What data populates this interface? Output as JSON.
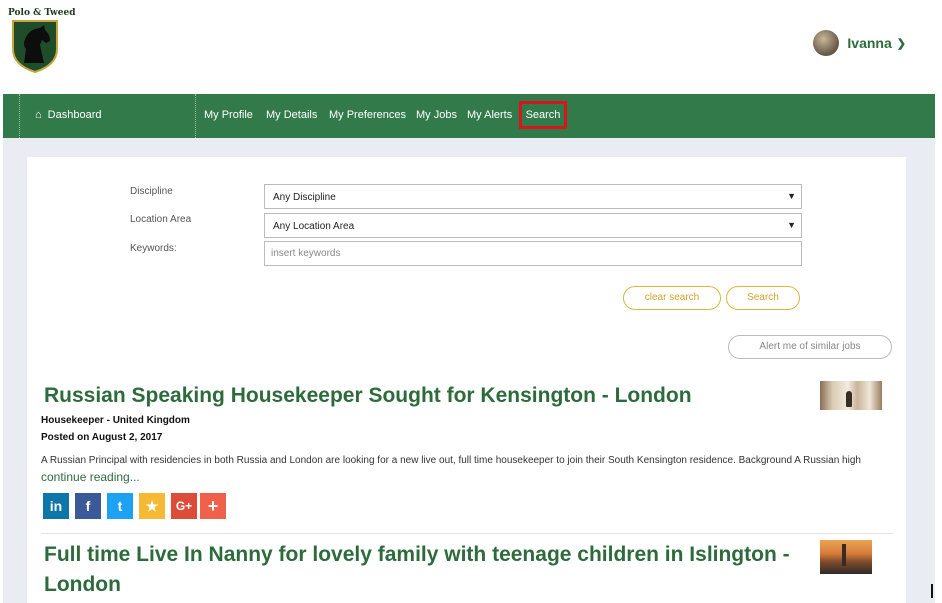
{
  "brand": {
    "logo_text": "Polo & Tweed"
  },
  "user": {
    "name": "Ivanna"
  },
  "nav": {
    "dashboard": "Dashboard",
    "items": [
      "My Profile",
      "My Details",
      "My Preferences",
      "My Jobs",
      "My Alerts"
    ],
    "search": "Search"
  },
  "form": {
    "discipline_label": "Discipline",
    "discipline_value": "Any Discipline",
    "location_label": "Location Area",
    "location_value": "Any Location Area",
    "keywords_label": "Keywords:",
    "keywords_placeholder": "insert keywords",
    "clear_button": "clear search",
    "search_button": "Search",
    "alert_button": "Alert me of similar jobs"
  },
  "jobs": [
    {
      "title": "Russian Speaking Housekeeper Sought for Kensington - London",
      "category": "Housekeeper - United Kingdom",
      "posted": "Posted on August 2, 2017",
      "description": "A Russian Principal with residencies in both Russia and London are looking for a new live out, full time housekeeper to join their South Kensington residence. Background A Russian high",
      "continue": "continue reading..."
    },
    {
      "title_line1": "Full time Live In Nanny for lovely family with teenage children in Islington -",
      "title_line2": "London"
    }
  ],
  "share": {
    "linkedin": "in",
    "facebook": "f",
    "twitter": "t",
    "favorite": "★",
    "googleplus": "G+",
    "more": "+"
  },
  "colors": {
    "nav_green": "#337a4a",
    "title_green": "#2e6b3c",
    "highlight_red": "#d9141d",
    "button_gold": "#e0b43a",
    "linkedin": "#0e76a8",
    "facebook": "#3b5998",
    "twitter": "#1da1f2",
    "favorite": "#f5b933",
    "googleplus": "#dd4b39",
    "more": "#f0614b"
  }
}
